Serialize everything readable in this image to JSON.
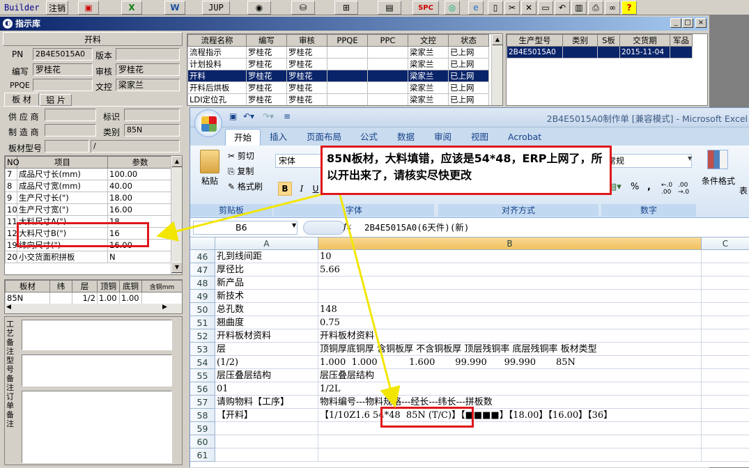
{
  "toolbar": {
    "builder": "Builder",
    "logout": "注销",
    "jup": "JUP",
    "spc": "SPC",
    "icon_names": [
      "app-icon",
      "excel-icon",
      "word-icon",
      "eye-icon",
      "database-icon",
      "network-icon",
      "printer-icon",
      "globe-icon",
      "ie-icon",
      "file-icon",
      "cut-icon",
      "close-icon",
      "save-icon",
      "undo-icon",
      "paste-icon",
      "print-icon",
      "binoculars-icon",
      "help-icon"
    ]
  },
  "window": {
    "title": "指示库",
    "minimize": "_",
    "maximize": "□",
    "close": "×"
  },
  "left_panel": {
    "header": "开料",
    "pn_label": "PN",
    "pn_value": "2B4E5015A0",
    "version_label": "版本",
    "version_value": "",
    "author_label": "编写",
    "author_value": "罗桂花",
    "review_label": "审核",
    "review_value": "罗桂花",
    "ppqe_label": "PPQE",
    "ppqe_value": "",
    "doc_control_label": "文控",
    "doc_control_value": "梁家兰",
    "tabs": [
      "板 材",
      "铝 片"
    ],
    "supplier_label": "供 应 商",
    "supplier_value": "",
    "mark_label": "标识",
    "mark_value": "",
    "manufacturer_label": "制 造 商",
    "manufacturer_value": "",
    "category_label": "类别",
    "category_value": "85N",
    "board_model_label": "板材型号",
    "board_model_value": "",
    "board_model_value2": "/",
    "param_table": {
      "headers": [
        "NO",
        "项目",
        "参数"
      ],
      "rows": [
        [
          "7",
          "成品尺寸长(mm)",
          "100.00"
        ],
        [
          "8",
          "成品尺寸宽(mm)",
          "40.00"
        ],
        [
          "9",
          "生产尺寸长(\")",
          "18.00"
        ],
        [
          "10",
          "生产尺寸宽(\")",
          "16.00"
        ],
        [
          "11",
          "大料尺寸A(\")",
          "18"
        ],
        [
          "12",
          "大料尺寸B(\")",
          "16"
        ],
        [
          "19",
          "纬向尺寸(\")",
          "16.00"
        ],
        [
          "20",
          "小交货面积拼板",
          "N"
        ]
      ]
    },
    "board_table": {
      "headers": [
        "板材",
        "纬",
        "层",
        "顶铜",
        "底铜",
        "含铜mm"
      ],
      "rows": [
        [
          "85N",
          "",
          "1/2",
          "1.00",
          "1.00",
          ""
        ]
      ]
    },
    "notes": [
      "工艺备注",
      "型号备注",
      "订单备注"
    ]
  },
  "process_table": {
    "headers": [
      "流程名称",
      "编写",
      "审核",
      "PPQE",
      "PPC",
      "文控",
      "状态"
    ],
    "rows": [
      [
        "流程指示",
        "罗桂花",
        "罗桂花",
        "",
        "",
        "梁家兰",
        "已上网"
      ],
      [
        "计划投料",
        "罗桂花",
        "罗桂花",
        "",
        "",
        "梁家兰",
        "已上网"
      ],
      [
        "开料",
        "罗桂花",
        "罗桂花",
        "",
        "",
        "梁家兰",
        "已上网"
      ],
      [
        "开料后烘板",
        "罗桂花",
        "罗桂花",
        "",
        "",
        "梁家兰",
        "已上网"
      ],
      [
        "LDI定位孔",
        "罗桂花",
        "罗桂花",
        "",
        "",
        "梁家兰",
        "已上网"
      ]
    ]
  },
  "order_table": {
    "headers": [
      "生产型号",
      "类别",
      "S板",
      "交货期",
      "军品"
    ],
    "rows": [
      [
        "2B4E5015A0",
        "",
        "",
        "2015-11-04",
        ""
      ]
    ]
  },
  "excel": {
    "title": "2B4E5015A0制作单 [兼容模式] - Microsoft Excel",
    "tabs": [
      "开始",
      "插入",
      "页面布局",
      "公式",
      "数据",
      "审阅",
      "视图",
      "Acrobat"
    ],
    "clipboard": {
      "cut": "剪切",
      "copy": "复制",
      "format_painter": "格式刷",
      "paste": "粘贴",
      "group": "剪贴板"
    },
    "font_name": "宋体",
    "font_group": "字体",
    "align_group": "对齐方式",
    "number_group": "数字",
    "number_format": "常规",
    "conditional": "条件格式",
    "table_fmt": "表",
    "name_box": "B6",
    "formula": "2B4E5015A0(6天件)(新)",
    "columns": [
      "A",
      "B",
      "C"
    ],
    "rows": [
      [
        "46",
        "孔到线间距",
        "10"
      ],
      [
        "47",
        "厚径比",
        "5.66"
      ],
      [
        "48",
        "新产品",
        ""
      ],
      [
        "49",
        "新技术",
        ""
      ],
      [
        "50",
        "总孔数",
        "148"
      ],
      [
        "51",
        "翘曲度",
        "0.75"
      ],
      [
        "52",
        "开料板材资料",
        "开料板材资料"
      ],
      [
        "53",
        "层",
        "顶铜厚底铜厚 含铜板厚 不含铜板厚 顶层残铜率 底层残铜率 板材类型"
      ],
      [
        "54",
        "(1/2)",
        "1.000  1.000           1.600       99.990      99.990       85N"
      ],
      [
        "55",
        "层压叠层结构",
        "层压叠层结构"
      ],
      [
        "56",
        "01",
        "1/2L"
      ],
      [
        "57",
        "请购物料【工序】",
        "物料编号---物料规格---经长---纬长---拼板数"
      ],
      [
        "58",
        "【开料】",
        "【1/10Z1.6 54*48  85N (T/C)】【■■■■】【18.00】【16.00】【36】"
      ],
      [
        "59",
        "",
        ""
      ],
      [
        "60",
        "",
        ""
      ],
      [
        "61",
        "",
        ""
      ]
    ]
  },
  "callout": {
    "text": "85N板材，大料填错，应该是54*48，ERP上网了，所以开出来了，请核实尽快更改"
  },
  "colors": {
    "annotation_red": "#e0161b",
    "arrow_yellow": "#f2e600",
    "selection_blue": "#0a246a"
  }
}
